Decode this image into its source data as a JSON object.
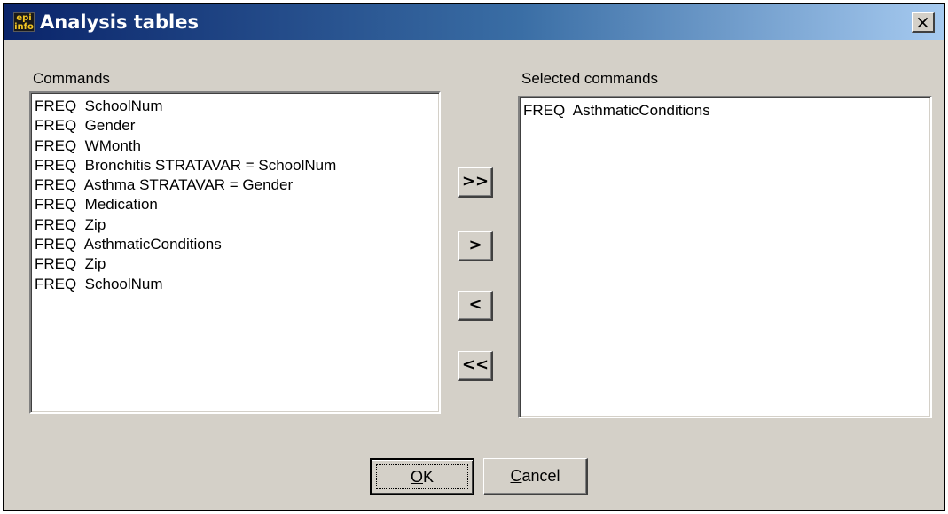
{
  "window": {
    "title": "Analysis tables",
    "icon": "epi-info-icon",
    "icon_lines": [
      "epi",
      "info"
    ],
    "close_label": "×"
  },
  "commands": {
    "label": "Commands",
    "items": [
      "FREQ  SchoolNum",
      "FREQ  Gender",
      "FREQ  WMonth",
      "FREQ  Bronchitis STRATAVAR = SchoolNum",
      "FREQ  Asthma STRATAVAR = Gender",
      "FREQ  Medication",
      "FREQ  Zip",
      "FREQ  AsthmaticConditions",
      "FREQ  Zip",
      "FREQ  SchoolNum"
    ]
  },
  "selected": {
    "label": "Selected commands",
    "items": [
      "FREQ  AsthmaticConditions"
    ]
  },
  "transfer": {
    "add_all": ">>",
    "add_one": ">",
    "remove_one": "<",
    "remove_all": "<<"
  },
  "buttons": {
    "ok_mnemonic": "O",
    "ok_rest": "K",
    "cancel_mnemonic": "C",
    "cancel_rest": "ancel"
  }
}
